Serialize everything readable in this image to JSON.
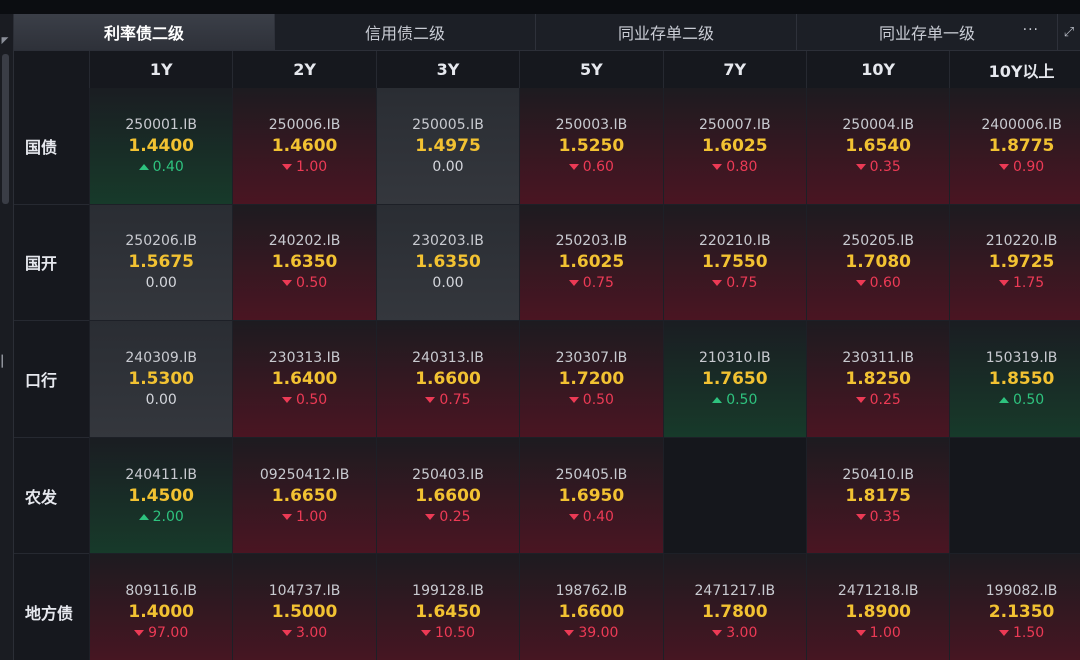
{
  "tabs": [
    {
      "label": "利率债二级",
      "active": true
    },
    {
      "label": "信用债二级",
      "active": false
    },
    {
      "label": "同业存单二级",
      "active": false
    },
    {
      "label": "同业存单一级",
      "active": false
    }
  ],
  "tab_more_label": "···",
  "tab_expand_icon": "expand-icon",
  "colors": {
    "yield": "#f2c232",
    "up": "#2ec27e",
    "down": "#ec3a55",
    "flat": "#d4d6dc"
  },
  "columns": [
    "1Y",
    "2Y",
    "3Y",
    "5Y",
    "7Y",
    "10Y",
    "10Y以上"
  ],
  "rows": [
    {
      "label": "国债",
      "cells": [
        {
          "code": "250001.IB",
          "yield": "1.4400",
          "change": "0.40",
          "dir": "up"
        },
        {
          "code": "250006.IB",
          "yield": "1.4600",
          "change": "1.00",
          "dir": "down"
        },
        {
          "code": "250005.IB",
          "yield": "1.4975",
          "change": "0.00",
          "dir": "flat"
        },
        {
          "code": "250003.IB",
          "yield": "1.5250",
          "change": "0.60",
          "dir": "down"
        },
        {
          "code": "250007.IB",
          "yield": "1.6025",
          "change": "0.80",
          "dir": "down"
        },
        {
          "code": "250004.IB",
          "yield": "1.6540",
          "change": "0.35",
          "dir": "down"
        },
        {
          "code": "2400006.IB",
          "yield": "1.8775",
          "change": "0.90",
          "dir": "down"
        }
      ]
    },
    {
      "label": "国开",
      "cells": [
        {
          "code": "250206.IB",
          "yield": "1.5675",
          "change": "0.00",
          "dir": "flat"
        },
        {
          "code": "240202.IB",
          "yield": "1.6350",
          "change": "0.50",
          "dir": "down"
        },
        {
          "code": "230203.IB",
          "yield": "1.6350",
          "change": "0.00",
          "dir": "flat"
        },
        {
          "code": "250203.IB",
          "yield": "1.6025",
          "change": "0.75",
          "dir": "down"
        },
        {
          "code": "220210.IB",
          "yield": "1.7550",
          "change": "0.75",
          "dir": "down"
        },
        {
          "code": "250205.IB",
          "yield": "1.7080",
          "change": "0.60",
          "dir": "down"
        },
        {
          "code": "210220.IB",
          "yield": "1.9725",
          "change": "1.75",
          "dir": "down"
        }
      ]
    },
    {
      "label": "口行",
      "cells": [
        {
          "code": "240309.IB",
          "yield": "1.5300",
          "change": "0.00",
          "dir": "flat"
        },
        {
          "code": "230313.IB",
          "yield": "1.6400",
          "change": "0.50",
          "dir": "down"
        },
        {
          "code": "240313.IB",
          "yield": "1.6600",
          "change": "0.75",
          "dir": "down"
        },
        {
          "code": "230307.IB",
          "yield": "1.7200",
          "change": "0.50",
          "dir": "down"
        },
        {
          "code": "210310.IB",
          "yield": "1.7650",
          "change": "0.50",
          "dir": "up"
        },
        {
          "code": "230311.IB",
          "yield": "1.8250",
          "change": "0.25",
          "dir": "down"
        },
        {
          "code": "150319.IB",
          "yield": "1.8550",
          "change": "0.50",
          "dir": "up"
        }
      ]
    },
    {
      "label": "农发",
      "cells": [
        {
          "code": "240411.IB",
          "yield": "1.4500",
          "change": "2.00",
          "dir": "up"
        },
        {
          "code": "09250412.IB",
          "yield": "1.6650",
          "change": "1.00",
          "dir": "down"
        },
        {
          "code": "250403.IB",
          "yield": "1.6600",
          "change": "0.25",
          "dir": "down"
        },
        {
          "code": "250405.IB",
          "yield": "1.6950",
          "change": "0.40",
          "dir": "down"
        },
        null,
        {
          "code": "250410.IB",
          "yield": "1.8175",
          "change": "0.35",
          "dir": "down"
        },
        null
      ]
    },
    {
      "label": "地方债",
      "cells": [
        {
          "code": "809116.IB",
          "yield": "1.4000",
          "change": "97.00",
          "dir": "down"
        },
        {
          "code": "104737.IB",
          "yield": "1.5000",
          "change": "3.00",
          "dir": "down"
        },
        {
          "code": "199128.IB",
          "yield": "1.6450",
          "change": "10.50",
          "dir": "down"
        },
        {
          "code": "198762.IB",
          "yield": "1.6600",
          "change": "39.00",
          "dir": "down"
        },
        {
          "code": "2471217.IB",
          "yield": "1.7800",
          "change": "3.00",
          "dir": "down"
        },
        {
          "code": "2471218.IB",
          "yield": "1.8900",
          "change": "1.00",
          "dir": "down"
        },
        {
          "code": "199082.IB",
          "yield": "2.1350",
          "change": "1.50",
          "dir": "down"
        }
      ]
    }
  ]
}
